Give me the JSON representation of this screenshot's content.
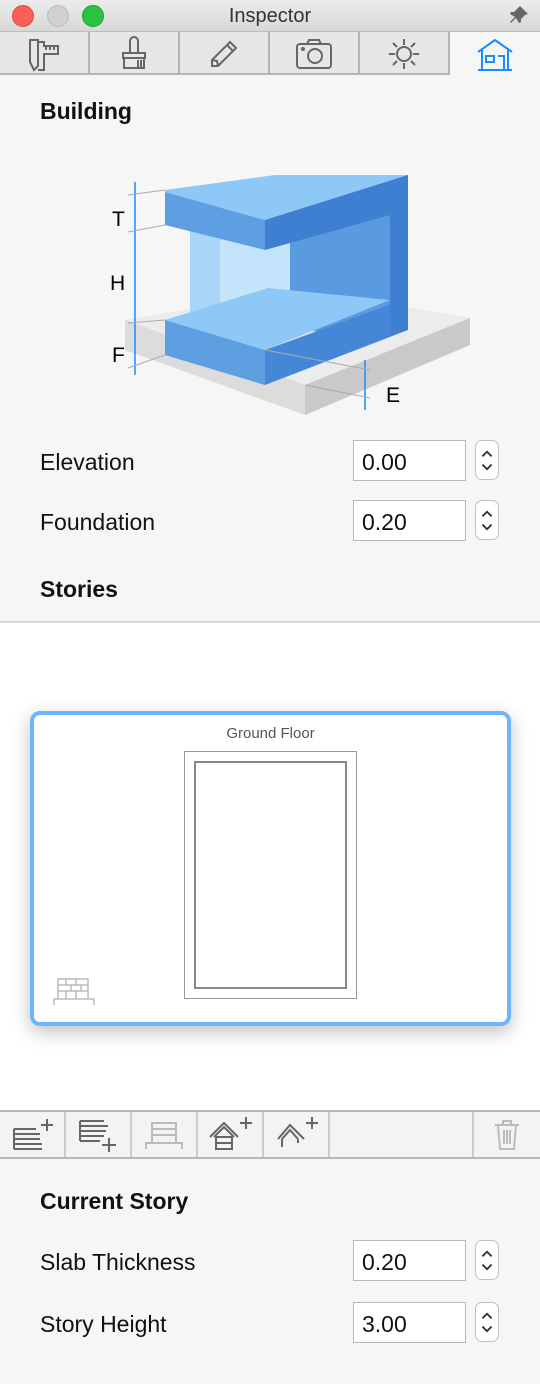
{
  "window": {
    "title": "Inspector"
  },
  "tabs": [
    {
      "icon": "caliper-icon"
    },
    {
      "icon": "brush-icon"
    },
    {
      "icon": "pencil-icon"
    },
    {
      "icon": "camera-icon"
    },
    {
      "icon": "sun-icon"
    },
    {
      "icon": "house-icon",
      "active": true
    }
  ],
  "building": {
    "heading": "Building",
    "diagram_labels": {
      "t": "T",
      "h": "H",
      "f": "F",
      "e": "E"
    },
    "elevation": {
      "label": "Elevation",
      "value": "0.00"
    },
    "foundation": {
      "label": "Foundation",
      "value": "0.20"
    }
  },
  "stories": {
    "heading": "Stories",
    "items": [
      {
        "name": "Ground Floor",
        "selected": true
      }
    ]
  },
  "story_toolbar": [
    "add-story-above-icon",
    "add-story-below-icon",
    "foundation-icon",
    "add-roof-icon",
    "add-roof-outline-icon",
    "trash-icon"
  ],
  "current_story": {
    "heading": "Current Story",
    "slab_thickness": {
      "label": "Slab Thickness",
      "value": "0.20"
    },
    "story_height": {
      "label": "Story Height",
      "value": "3.00"
    }
  },
  "colors": {
    "accent": "#1a8cff",
    "selection": "#6bb6ff"
  }
}
